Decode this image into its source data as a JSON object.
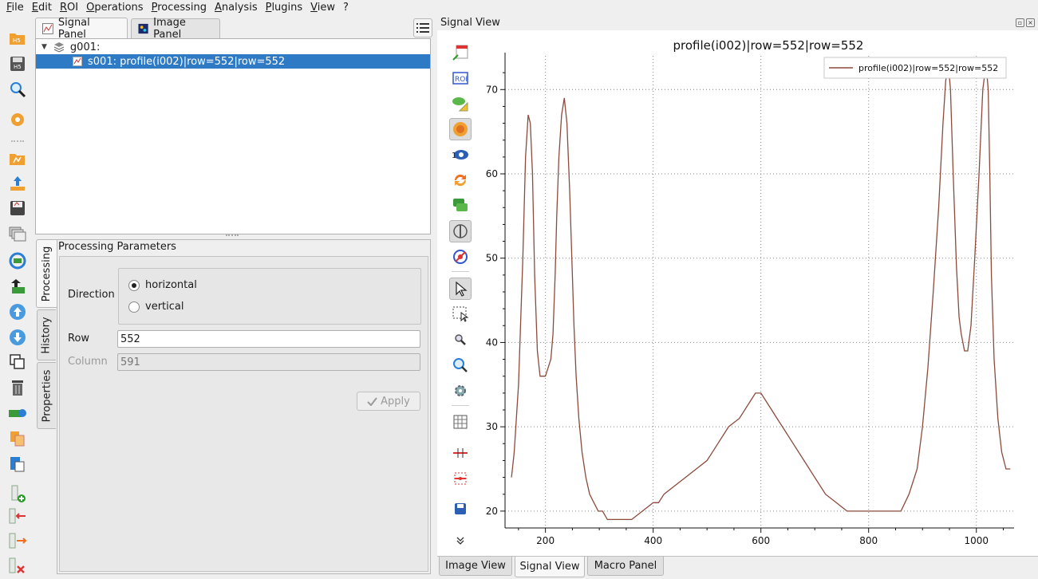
{
  "menubar": {
    "items": [
      "File",
      "Edit",
      "ROI",
      "Operations",
      "Processing",
      "Analysis",
      "Plugins",
      "View",
      "?"
    ]
  },
  "left_toolbar": {
    "icons": [
      "open-h5-icon",
      "save-h5-icon",
      "search-h5-icon",
      "settings-icon",
      "open-file-icon",
      "upload-icon",
      "save-file-icon",
      "duplicate-windows-icon",
      "refresh-signal-icon",
      "import-signal-icon",
      "move-up-icon",
      "move-down-icon",
      "copy-icon",
      "delete-icon",
      "new-group-icon",
      "copy-metadata-icon",
      "paste-metadata-icon",
      "add-roi-icon",
      "export-roi-icon",
      "import-roi-icon",
      "delete-roi-icon"
    ]
  },
  "panel_tabs": {
    "signal_panel": "Signal Panel",
    "image_panel": "Image Panel"
  },
  "tree": {
    "group": "g001:",
    "signal": "s001: profile(i002)|row=552|row=552"
  },
  "vertical_tabs": {
    "processing": "Processing",
    "history": "History",
    "properties": "Properties"
  },
  "params": {
    "title": "Processing Parameters",
    "direction_label": "Direction",
    "horizontal_label": "horizontal",
    "vertical_label": "vertical",
    "selected_direction": "horizontal",
    "row_label": "Row",
    "row_value": "552",
    "column_label": "Column",
    "column_placeholder": "591",
    "apply_label": "Apply"
  },
  "signal_view": {
    "title": "Signal View"
  },
  "bottom_tabs": {
    "image_view": "Image View",
    "signal_view": "Signal View",
    "macro_panel": "Macro Panel"
  },
  "colors": {
    "selection": "#2f7ac5",
    "curve": "#8b4a3c",
    "accent_orange": "#f0a030",
    "accent_blue": "#2a7fd4"
  },
  "chart_data": {
    "type": "line",
    "title": "profile(i002)|row=552|row=552",
    "xlabel": "",
    "ylabel": "",
    "xlim": [
      125,
      1070
    ],
    "ylim": [
      18,
      74
    ],
    "xticks": [
      200,
      400,
      600,
      800,
      1000
    ],
    "yticks": [
      20,
      30,
      40,
      50,
      60,
      70
    ],
    "grid": true,
    "legend": "top-right",
    "series": [
      {
        "name": "profile(i002)|row=552|row=552",
        "x": [
          137,
          142,
          150,
          158,
          163,
          168,
          172,
          176,
          180,
          185,
          190,
          195,
          200,
          205,
          210,
          214,
          218,
          221,
          225,
          230,
          235,
          240,
          245,
          250,
          253,
          257,
          262,
          268,
          275,
          282,
          290,
          298,
          306,
          315,
          325,
          340,
          355,
          360,
          380,
          400,
          410,
          420,
          440,
          460,
          480,
          500,
          520,
          540,
          560,
          580,
          590,
          600,
          610,
          620,
          630,
          640,
          660,
          680,
          700,
          720,
          740,
          760,
          780,
          800,
          830,
          860,
          875,
          890,
          900,
          910,
          920,
          930,
          938,
          943,
          948,
          952,
          957,
          963,
          968,
          972,
          978,
          984,
          990,
          997,
          1005,
          1012,
          1018,
          1022,
          1025,
          1028,
          1033,
          1040,
          1047,
          1055,
          1063
        ],
        "y": [
          24,
          27,
          35,
          50,
          62,
          67,
          66,
          60,
          48,
          39,
          36,
          36,
          36,
          37,
          38,
          41,
          48,
          55,
          62,
          67,
          69,
          66,
          58,
          48,
          42,
          36,
          31,
          27,
          24,
          22,
          21,
          20,
          20,
          19,
          19,
          19,
          19,
          19,
          20,
          21,
          21,
          22,
          23,
          24,
          25,
          26,
          28,
          30,
          31,
          33,
          34,
          34,
          33,
          32,
          31,
          30,
          28,
          26,
          24,
          22,
          21,
          20,
          20,
          20,
          20,
          20,
          22,
          25,
          30,
          37,
          46,
          56,
          66,
          71,
          73,
          70,
          60,
          49,
          43,
          41,
          39,
          39,
          42,
          50,
          60,
          70,
          73,
          70,
          60,
          48,
          38,
          31,
          27,
          25,
          25
        ]
      }
    ]
  }
}
